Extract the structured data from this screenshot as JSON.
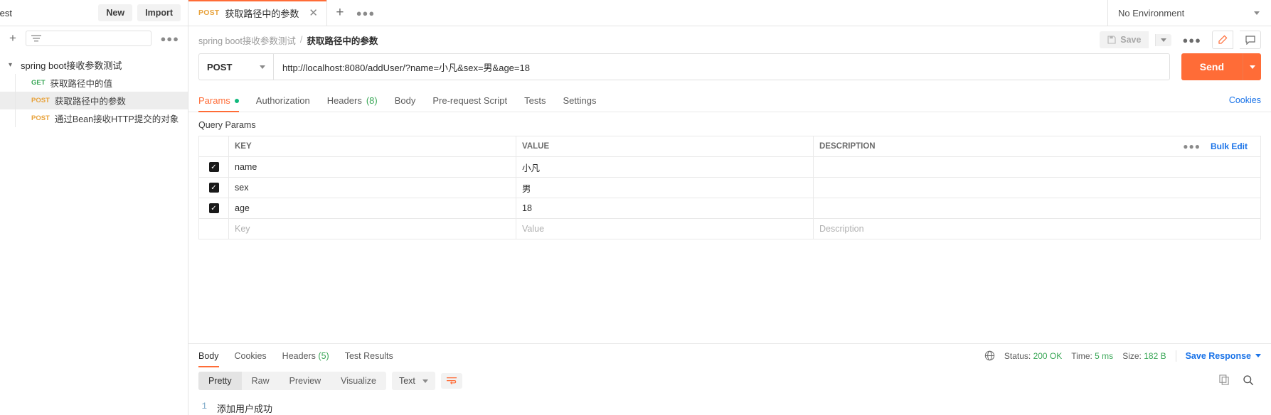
{
  "topbar": {
    "workspace": "test",
    "new_label": "New",
    "import_label": "Import",
    "environment": "No Environment",
    "tab": {
      "method": "POST",
      "title": "获取路径中的参数"
    }
  },
  "sidebar": {
    "collection": {
      "name": "spring boot接收参数测试"
    },
    "requests": [
      {
        "method": "GET",
        "name": "获取路径中的值",
        "selected": false
      },
      {
        "method": "POST",
        "name": "获取路径中的参数",
        "selected": true
      },
      {
        "method": "POST",
        "name": "通过Bean接收HTTP提交的对象",
        "selected": false
      }
    ]
  },
  "breadcrumb": {
    "collection": "spring boot接收参数测试",
    "separator": "/",
    "current": "获取路径中的参数",
    "save_label": "Save"
  },
  "request": {
    "method": "POST",
    "url": "http://localhost:8080/addUser/?name=小凡&sex=男&age=18",
    "send_label": "Send",
    "tabs": [
      {
        "label": "Params",
        "badge": "dot",
        "active": true
      },
      {
        "label": "Authorization",
        "badge": "",
        "active": false
      },
      {
        "label": "Headers",
        "badge": "(8)",
        "active": false
      },
      {
        "label": "Body",
        "badge": "",
        "active": false
      },
      {
        "label": "Pre-request Script",
        "badge": "",
        "active": false
      },
      {
        "label": "Tests",
        "badge": "",
        "active": false
      },
      {
        "label": "Settings",
        "badge": "",
        "active": false
      }
    ],
    "cookies_link": "Cookies"
  },
  "params": {
    "section_title": "Query Params",
    "columns": {
      "key": "KEY",
      "value": "VALUE",
      "description": "DESCRIPTION"
    },
    "bulk_edit": "Bulk Edit",
    "rows": [
      {
        "checked": true,
        "key": "name",
        "value": "小凡",
        "description": ""
      },
      {
        "checked": true,
        "key": "sex",
        "value": "男",
        "description": ""
      },
      {
        "checked": true,
        "key": "age",
        "value": "18",
        "description": ""
      }
    ],
    "placeholders": {
      "key": "Key",
      "value": "Value",
      "description": "Description"
    }
  },
  "response": {
    "tabs": [
      {
        "label": "Body",
        "badge": "",
        "active": true
      },
      {
        "label": "Cookies",
        "badge": "",
        "active": false
      },
      {
        "label": "Headers",
        "badge": "(5)",
        "active": false
      },
      {
        "label": "Test Results",
        "badge": "",
        "active": false
      }
    ],
    "status_label": "Status:",
    "status_value": "200 OK",
    "time_label": "Time:",
    "time_value": "5 ms",
    "size_label": "Size:",
    "size_value": "182 B",
    "save_response": "Save Response",
    "views": [
      {
        "label": "Pretty",
        "active": true
      },
      {
        "label": "Raw",
        "active": false
      },
      {
        "label": "Preview",
        "active": false
      },
      {
        "label": "Visualize",
        "active": false
      }
    ],
    "format": "Text",
    "body_lines": [
      {
        "n": "1",
        "text": "添加用户成功"
      }
    ]
  },
  "colors": {
    "accent": "#ff6c37",
    "link": "#1a73e8",
    "success": "#3aa757",
    "method_post": "#e8a33d",
    "method_get": "#3aa757"
  }
}
